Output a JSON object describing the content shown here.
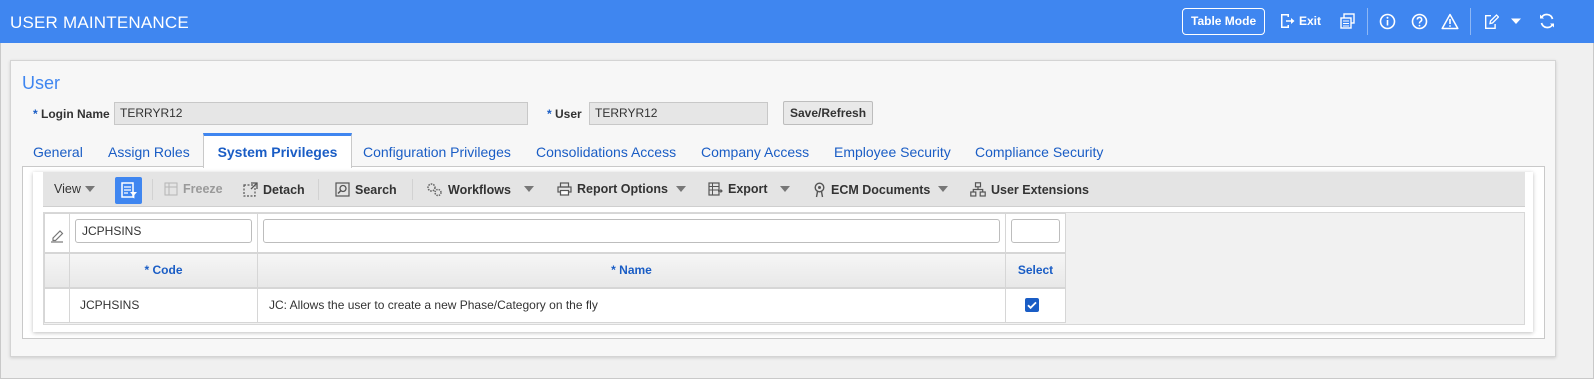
{
  "app": {
    "title": "USER MAINTENANCE",
    "accent_color": "#3f86f0",
    "toolbar": {
      "table_mode_label": "Table Mode",
      "exit_label": "Exit",
      "icons": [
        "exit-icon",
        "print-icon",
        "info-icon",
        "help-icon",
        "warning-icon",
        "edit-icon",
        "chevron-down-icon",
        "refresh-icon"
      ]
    }
  },
  "form": {
    "section_title": "User",
    "login_name_label": "Login Name",
    "login_name_value": "TERRYR12",
    "user_label": "User",
    "user_value": "TERRYR12",
    "required_marker": "*",
    "save_refresh_label": "Save/Refresh"
  },
  "tabs": [
    {
      "label": "General",
      "active": false
    },
    {
      "label": "Assign Roles",
      "active": false
    },
    {
      "label": "System Privileges",
      "active": true
    },
    {
      "label": "Configuration Privileges",
      "active": false
    },
    {
      "label": "Consolidations Access",
      "active": false
    },
    {
      "label": "Company Access",
      "active": false
    },
    {
      "label": "Employee Security",
      "active": false
    },
    {
      "label": "Compliance Security",
      "active": false
    }
  ],
  "grid_toolbar": {
    "view": "View",
    "freeze": "Freeze",
    "detach": "Detach",
    "search": "Search",
    "workflows": "Workflows",
    "report_options": "Report Options",
    "export": "Export",
    "ecm_documents": "ECM Documents",
    "user_extensions": "User Extensions"
  },
  "grid": {
    "filters": {
      "code": "JCPHSINS",
      "name": "",
      "select": ""
    },
    "columns": [
      "* Code",
      "* Name",
      "Select"
    ],
    "rows": [
      {
        "code": "JCPHSINS",
        "name": "JC: Allows the user to create a new Phase/Category on the fly",
        "select": true
      }
    ]
  }
}
